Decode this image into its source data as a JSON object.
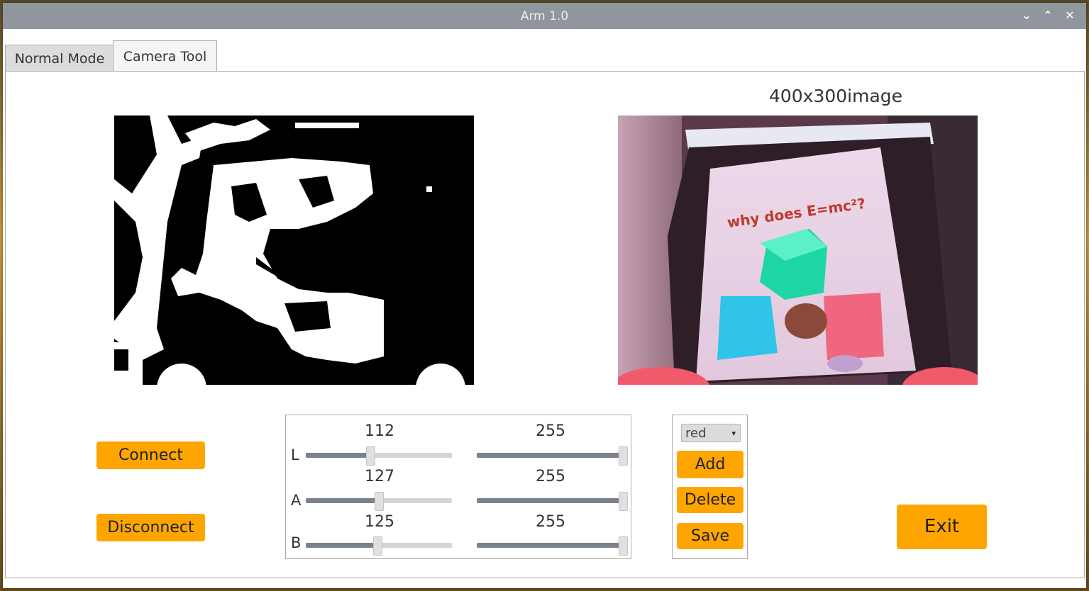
{
  "window": {
    "title": "Arm 1.0"
  },
  "window_controls": {
    "minimize": "⌄",
    "maximize": "⌃",
    "close": "✕"
  },
  "tabs": [
    {
      "label": "Normal Mode",
      "active": false
    },
    {
      "label": "Camera Tool",
      "active": true
    }
  ],
  "camera": {
    "image_label": "400x300image"
  },
  "connection": {
    "connect_label": "Connect",
    "disconnect_label": "Disconnect"
  },
  "sliders": [
    {
      "channel": "L",
      "min_value": "112",
      "max_value": "255",
      "min_level": 0.44,
      "max_level": 1.0
    },
    {
      "channel": "A",
      "min_value": "127",
      "max_value": "255",
      "min_level": 0.5,
      "max_level": 1.0
    },
    {
      "channel": "B",
      "min_value": "125",
      "max_value": "255",
      "min_level": 0.49,
      "max_level": 1.0
    }
  ],
  "color_panel": {
    "selected_color": "red",
    "add_label": "Add",
    "delete_label": "Delete",
    "save_label": "Save"
  },
  "exit_label": "Exit",
  "colors": {
    "accent": "#ffa500",
    "titlebar": "#8f969d",
    "slider_fill": "#7a828c"
  }
}
